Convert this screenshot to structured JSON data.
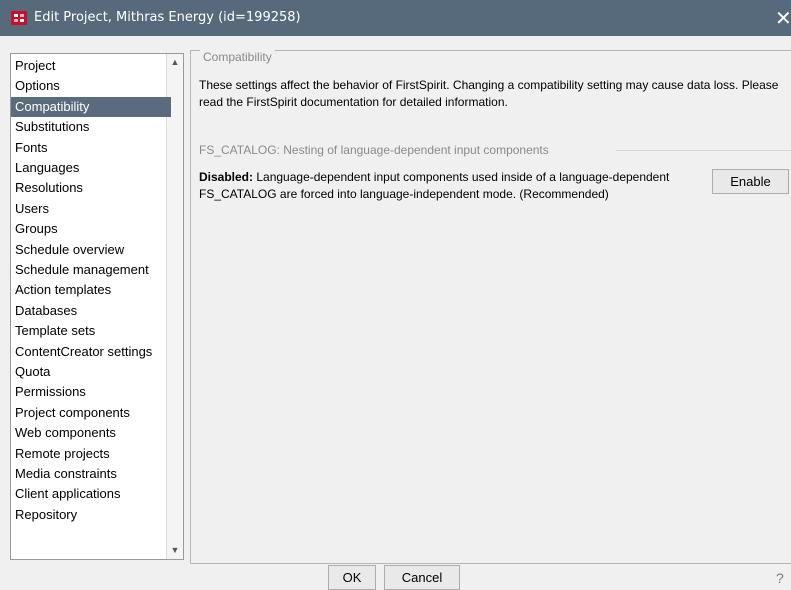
{
  "window": {
    "title": "Edit Project, Mithras Energy (id=199258)",
    "close_glyph": "✕",
    "app_icon": "firstspirit-app-icon"
  },
  "sidebar": {
    "items": [
      {
        "label": "Project"
      },
      {
        "label": "Options"
      },
      {
        "label": "Compatibility",
        "selected": true
      },
      {
        "label": "Substitutions"
      },
      {
        "label": "Fonts"
      },
      {
        "label": "Languages"
      },
      {
        "label": "Resolutions"
      },
      {
        "label": "Users"
      },
      {
        "label": "Groups"
      },
      {
        "label": "Schedule overview"
      },
      {
        "label": "Schedule management"
      },
      {
        "label": "Action templates"
      },
      {
        "label": "Databases"
      },
      {
        "label": "Template sets"
      },
      {
        "label": "ContentCreator settings"
      },
      {
        "label": "Quota"
      },
      {
        "label": "Permissions"
      },
      {
        "label": "Project components"
      },
      {
        "label": "Web components"
      },
      {
        "label": "Remote projects"
      },
      {
        "label": "Media constraints"
      },
      {
        "label": "Client applications"
      },
      {
        "label": "Repository"
      }
    ]
  },
  "main": {
    "group_title": "Compatibility",
    "description": "These settings affect the behavior of FirstSpirit. Changing a compatibility setting may cause data loss. Please read the FirstSpirit documentation for detailed information.",
    "setting_title": "FS_CATALOG: Nesting of language-dependent input components",
    "setting_status": "Disabled:",
    "setting_text": "Language-dependent input components used inside of a language-dependent FS_CATALOG are forced into language-independent mode. (Recommended)",
    "enable_label": "Enable"
  },
  "footer": {
    "ok_label": "OK",
    "cancel_label": "Cancel",
    "help_glyph": "?"
  },
  "colors": {
    "titlebar": "#566a7c",
    "selection": "#5a6b7d",
    "icon_red": "#c8102e"
  }
}
